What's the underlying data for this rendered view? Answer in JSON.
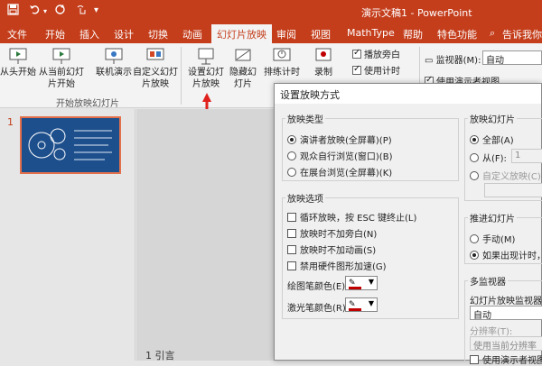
{
  "window": {
    "title": "演示文稿1 - PowerPoint",
    "accent": "#c43e1c"
  },
  "quick_access": {
    "save_icon": "save-icon",
    "undo_icon": "undo-icon",
    "redo_icon": "redo-icon",
    "touch_icon": "touch-mode-icon"
  },
  "tabs": [
    "文件",
    "开始",
    "插入",
    "设计",
    "切换",
    "动画",
    "幻灯片放映",
    "审阅",
    "视图",
    "MathType",
    "帮助",
    "特色功能"
  ],
  "tell_me": "告诉我你",
  "ribbon": {
    "from_start": "从头开始",
    "from_current": "从当前幻灯片开始",
    "online": "联机演示",
    "custom": "自定义幻灯片放映",
    "group1_label": "开始放映幻灯片",
    "setup": "设置幻灯片放映",
    "hide": "隐藏幻灯片",
    "rehearse": "排练计时",
    "record": "录制",
    "play_narrations": "播放旁白",
    "use_timings": "使用计时",
    "monitor_label": "监视器(M):",
    "monitor_value": "自动",
    "presenter_view": "使用演示者视图"
  },
  "left_panel": {
    "slide_number": "1"
  },
  "notes_text": "1 引言",
  "dialog": {
    "title": "设置放映方式",
    "show_type": {
      "legend": "放映类型",
      "options": [
        "演讲者放映(全屏幕)(P)",
        "观众自行浏览(窗口)(B)",
        "在展台浏览(全屏幕)(K)"
      ],
      "selected": 0
    },
    "show_options": {
      "legend": "放映选项",
      "items": [
        "循环放映，按 ESC 键终止(L)",
        "放映时不加旁白(N)",
        "放映时不加动画(S)",
        "禁用硬件图形加速(G)"
      ],
      "pen_color_label": "绘图笔颜色(E):",
      "laser_color_label": "激光笔颜色(R):",
      "pen_color": "#c00000",
      "laser_color": "#c00000"
    },
    "slides": {
      "legend": "放映幻灯片",
      "all": "全部(A)",
      "from": "从(F):",
      "from_value": "1",
      "custom": "自定义放映(C):"
    },
    "advance": {
      "legend": "推进幻灯片",
      "manual": "手动(M)",
      "timings": "如果出现计时，则"
    },
    "multi_monitor": {
      "legend": "多监视器",
      "monitor_label": "幻灯片放映监视器(",
      "monitor_value": "自动",
      "resolution_label": "分辨率(T):",
      "resolution_value": "使用当前分辨率",
      "presenter_view": "使用演示者视图"
    }
  }
}
